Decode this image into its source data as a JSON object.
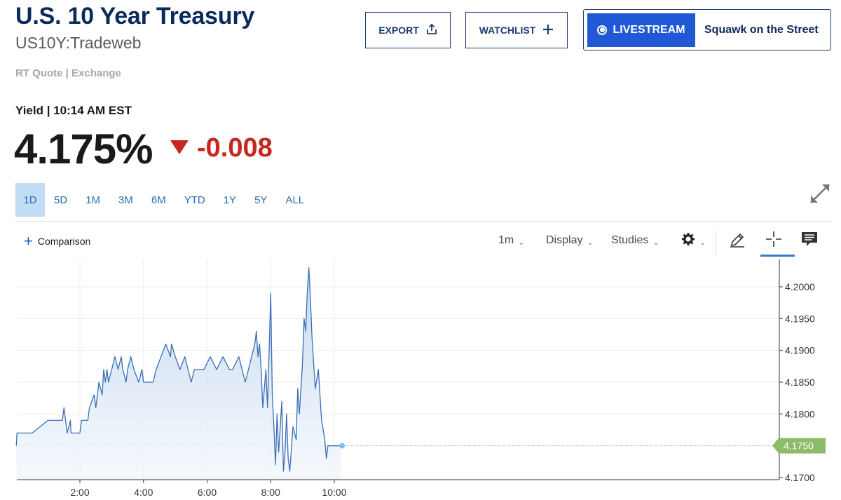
{
  "header": {
    "title": "U.S. 10 Year Treasury",
    "symbol": "US10Y:Tradeweb",
    "quote_source": "RT Quote | Exchange"
  },
  "actions": {
    "export_label": "EXPORT",
    "watchlist_label": "WATCHLIST",
    "livestream_label": "LIVESTREAM",
    "livestream_show": "Squawk on the Street"
  },
  "quote": {
    "yield_label": "Yield | 10:14 AM EST",
    "price": "4.175%",
    "change": "-0.008",
    "change_direction": "down",
    "down_color": "#c8261e"
  },
  "ranges": [
    "1D",
    "5D",
    "1M",
    "3M",
    "6M",
    "YTD",
    "1Y",
    "5Y",
    "ALL"
  ],
  "active_range": "1D",
  "toolbar": {
    "comparison_label": "Comparison",
    "interval_label": "1m",
    "display_label": "Display",
    "studies_label": "Studies",
    "icons": [
      "gear-icon",
      "pencil-icon",
      "crosshair-icon",
      "comment-icon",
      "expand-icon"
    ]
  },
  "chart_data": {
    "type": "area",
    "xlabel": "",
    "ylabel": "",
    "x_ticks": [
      "2:00",
      "4:00",
      "6:00",
      "8:00",
      "10:00"
    ],
    "y_ticks": [
      4.2,
      4.195,
      4.19,
      4.185,
      4.18,
      4.175,
      4.17
    ],
    "y_tick_labels": [
      "4.2000",
      "4.1950",
      "4.1900",
      "4.1850",
      "4.1800",
      "4.1750",
      "4.1700"
    ],
    "ylim": [
      4.1695,
      4.2055
    ],
    "xlim_hours": [
      0,
      24
    ],
    "grid": true,
    "line_color": "#3a6fb5",
    "fill_color": "#c9dcf0",
    "last_value": 4.175,
    "last_value_label": "4.1750",
    "last_badge_color": "#8dbb6a",
    "series": [
      {
        "x": [
          0.0,
          0.02,
          0.5,
          1.0,
          1.45,
          1.5,
          1.55,
          1.6,
          1.7,
          1.72,
          1.85,
          1.87,
          2.0,
          2.05,
          2.25,
          2.3,
          2.45,
          2.5,
          2.6,
          2.7,
          2.75,
          2.8,
          2.85,
          2.9,
          3.0,
          3.1,
          3.2,
          3.3,
          3.35,
          3.45,
          3.5,
          3.6,
          3.7,
          3.85,
          3.95,
          4.0,
          4.1,
          4.2,
          4.3,
          4.4,
          4.55,
          4.7,
          4.85,
          4.88,
          5.0,
          5.15,
          5.3,
          5.4,
          5.5,
          5.6,
          5.75,
          5.9,
          6.1,
          6.3,
          6.5,
          6.7,
          6.8,
          7.0,
          7.1,
          7.2,
          7.3,
          7.4,
          7.5,
          7.55,
          7.6,
          7.65,
          7.7,
          7.75,
          7.8,
          7.85,
          7.9,
          8.0,
          8.05,
          8.1,
          8.15,
          8.2,
          8.25,
          8.3,
          8.35,
          8.4,
          8.45,
          8.5,
          8.55,
          8.6,
          8.7,
          8.8,
          8.85,
          8.9,
          8.95,
          9.0,
          9.05,
          9.1,
          9.15,
          9.2,
          9.25,
          9.3,
          9.4,
          9.5,
          9.6,
          9.7,
          9.75,
          9.8,
          9.85,
          9.9,
          9.95,
          10.0,
          10.05,
          10.1,
          10.15,
          10.2
        ],
        "values": [
          4.175,
          4.177,
          4.177,
          4.179,
          4.179,
          4.181,
          4.179,
          4.177,
          4.179,
          4.177,
          4.177,
          4.177,
          4.177,
          4.179,
          4.179,
          4.181,
          4.183,
          4.181,
          4.185,
          4.183,
          4.187,
          4.185,
          4.187,
          4.185,
          4.187,
          4.189,
          4.187,
          4.189,
          4.187,
          4.185,
          4.187,
          4.189,
          4.187,
          4.185,
          4.187,
          4.185,
          4.185,
          4.185,
          4.185,
          4.187,
          4.189,
          4.191,
          4.189,
          4.191,
          4.189,
          4.187,
          4.189,
          4.187,
          4.185,
          4.187,
          4.187,
          4.187,
          4.189,
          4.187,
          4.189,
          4.187,
          4.187,
          4.189,
          4.187,
          4.185,
          4.187,
          4.189,
          4.191,
          4.193,
          4.189,
          4.191,
          4.187,
          4.181,
          4.184,
          4.187,
          4.181,
          4.199,
          4.183,
          4.178,
          4.172,
          4.18,
          4.174,
          4.178,
          4.182,
          4.171,
          4.174,
          4.18,
          4.173,
          4.171,
          4.178,
          4.176,
          4.184,
          4.18,
          4.184,
          4.188,
          4.195,
          4.193,
          4.199,
          4.203,
          4.198,
          4.192,
          4.184,
          4.187,
          4.179,
          4.176,
          4.173,
          4.175,
          4.175,
          4.175,
          4.175,
          4.175,
          4.175,
          4.175,
          4.175,
          4.175
        ]
      }
    ]
  }
}
